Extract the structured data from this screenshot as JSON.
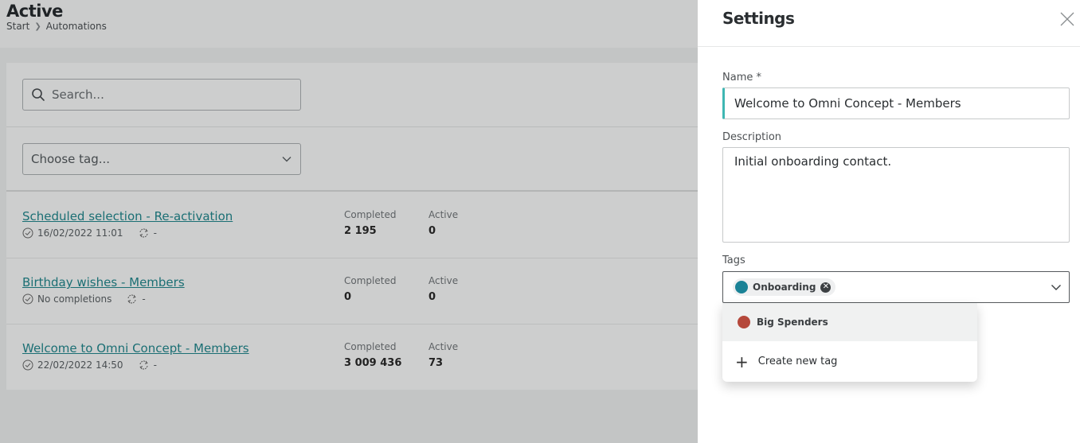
{
  "page": {
    "title": "Active",
    "breadcrumb": [
      "Start",
      "Automations"
    ]
  },
  "filters": {
    "search_placeholder": "Search...",
    "tag_placeholder": "Choose tag..."
  },
  "automations": [
    {
      "name": "Scheduled selection - Re-activation",
      "status_text": "16/02/2022 11:01",
      "repeat_text": "-",
      "completed_label": "Completed",
      "completed": "2 195",
      "active_label": "Active",
      "active": "0"
    },
    {
      "name": "Birthday wishes - Members",
      "status_text": "No completions",
      "repeat_text": "-",
      "completed_label": "Completed",
      "completed": "0",
      "active_label": "Active",
      "active": "0"
    },
    {
      "name": "Welcome to Omni Concept - Members",
      "status_text": "22/02/2022 14:50",
      "repeat_text": "-",
      "completed_label": "Completed",
      "completed": "3 009 436",
      "active_label": "Active",
      "active": "73"
    }
  ],
  "settings": {
    "title": "Settings",
    "name_label": "Name *",
    "name_value": "Welcome to Omni Concept - Members",
    "description_label": "Description",
    "description_value": "Initial onboarding contact.",
    "tags_label": "Tags",
    "selected_tags": [
      {
        "label": "Onboarding",
        "color": "#1a8296"
      }
    ],
    "dropdown": {
      "options": [
        {
          "label": "Big Spenders",
          "color": "#b5483b"
        }
      ],
      "create_label": "Create new tag"
    }
  },
  "colors": {
    "accent": "#3fb7b3",
    "link": "#1b6f74"
  },
  "icons": {
    "search": "search-icon",
    "chevron": "chevron-down-icon",
    "check_circle": "check-circle-icon",
    "repeat": "repeat-icon",
    "close": "close-icon",
    "plus": "plus-icon"
  }
}
